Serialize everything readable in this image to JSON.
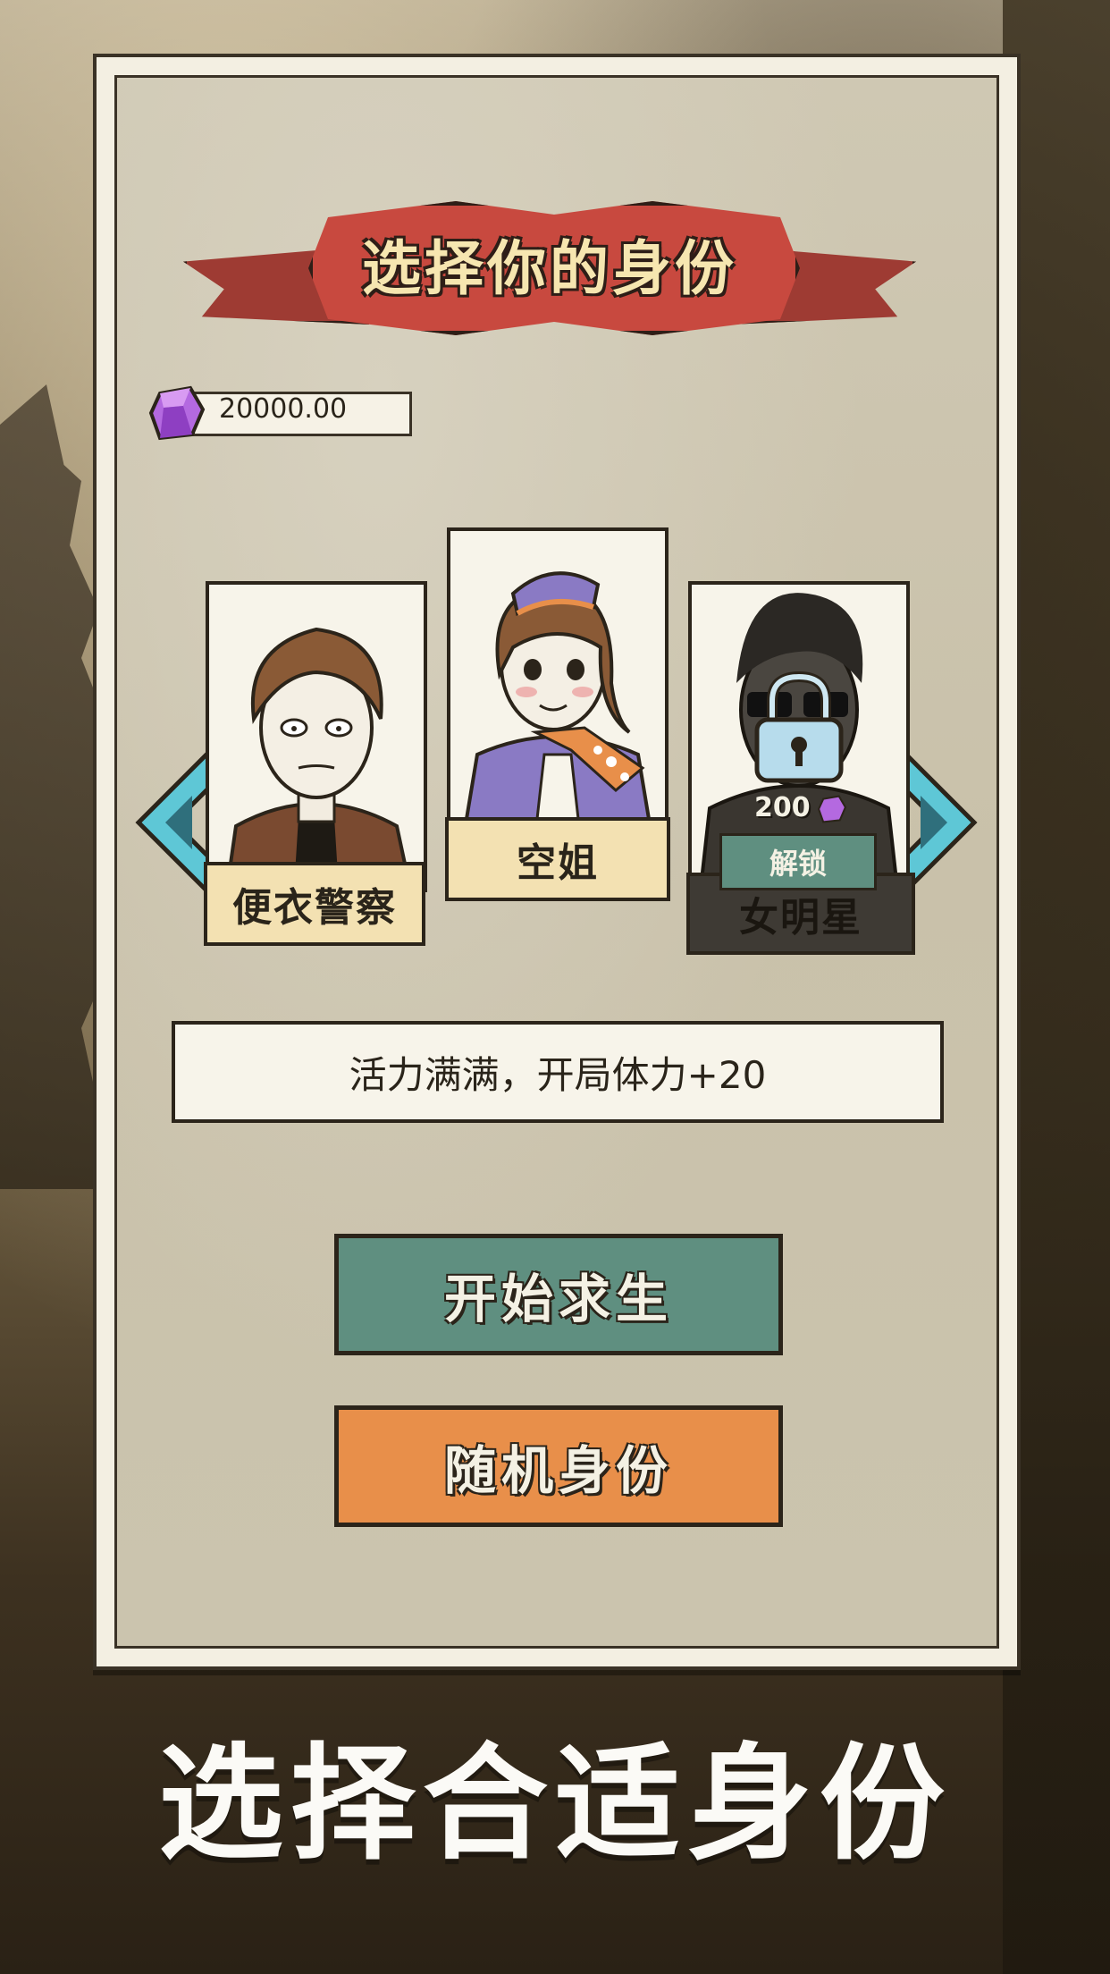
{
  "title": "选择你的身份",
  "currency": {
    "amount": "20000.00",
    "icon": "purple-gem-icon"
  },
  "characters": [
    {
      "name": "便衣警察",
      "locked": false
    },
    {
      "name": "空姐",
      "locked": false,
      "selected": true
    },
    {
      "name": "女明星",
      "locked": true,
      "price": "200",
      "unlock_label": "解锁"
    }
  ],
  "description": "活力满满，开局体力+20",
  "buttons": {
    "start": "开始求生",
    "random": "随机身份"
  },
  "caption": "选择合适身份",
  "colors": {
    "start_button": "#5f8f80",
    "random_button": "#e88f4a",
    "banner": "#c8493f",
    "arrow": "#5ec7d6",
    "gem": "#b469e0"
  }
}
